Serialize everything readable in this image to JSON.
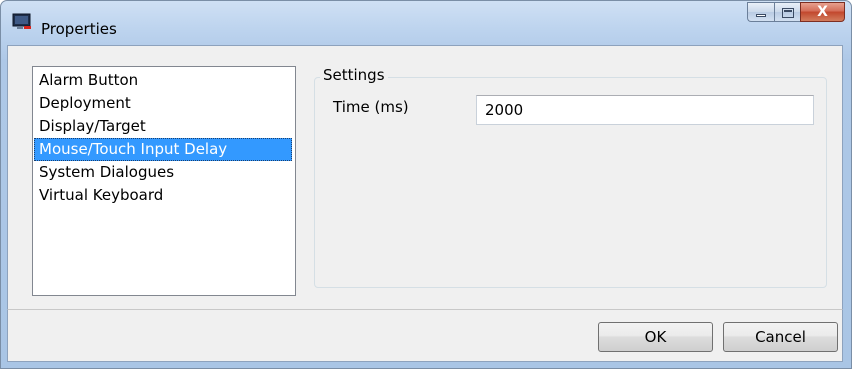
{
  "window": {
    "title": "Properties",
    "icon": "monitor-app-icon",
    "caption_buttons": {
      "minimize": "minimize-icon",
      "maximize": "maximize-icon",
      "close_glyph": "X"
    }
  },
  "categories": {
    "items": [
      {
        "label": "Alarm Button",
        "selected": false
      },
      {
        "label": "Deployment",
        "selected": false
      },
      {
        "label": "Display/Target",
        "selected": false
      },
      {
        "label": "Mouse/Touch Input Delay",
        "selected": true
      },
      {
        "label": "System Dialogues",
        "selected": false
      },
      {
        "label": "Virtual Keyboard",
        "selected": false
      }
    ]
  },
  "settings": {
    "group_label": "Settings",
    "time_label": "Time (ms)",
    "time_value": "2000"
  },
  "footer": {
    "ok_label": "OK",
    "cancel_label": "Cancel"
  },
  "colors": {
    "selection": "#3399ff",
    "close_button": "#c2472d",
    "title_gradient_top": "#cfe0f4",
    "client_bg": "#f0f0f0"
  }
}
